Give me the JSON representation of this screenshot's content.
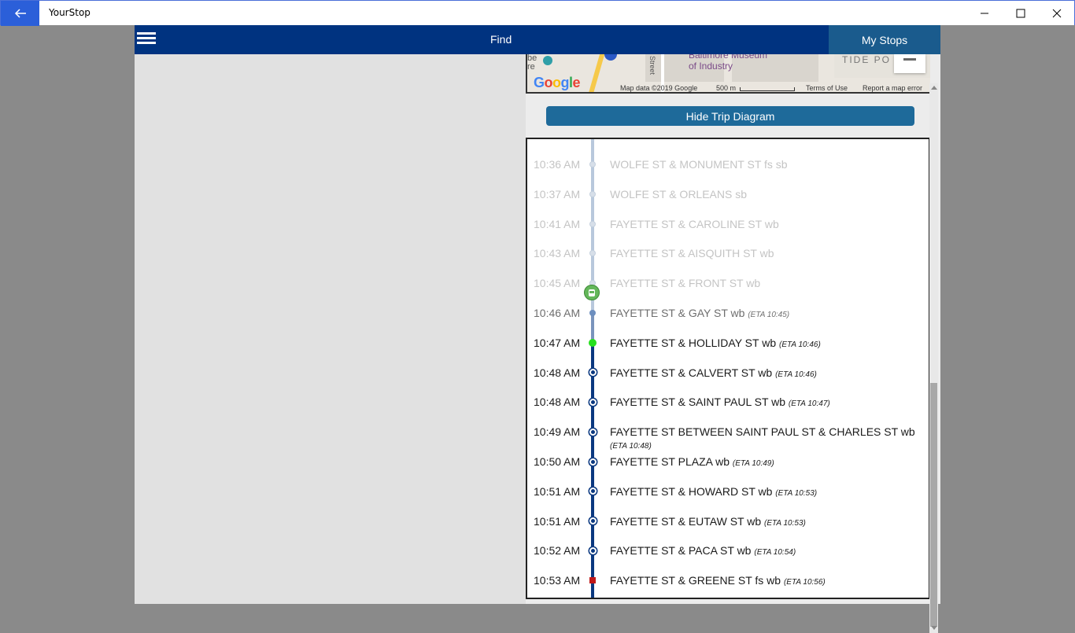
{
  "window": {
    "title": "YourStop",
    "back_icon": "arrow-left-icon",
    "controls": [
      "minimize-icon",
      "maximize-icon",
      "close-icon"
    ]
  },
  "appbar": {
    "menu_icon": "hamburger-icon",
    "find_label": "Find",
    "mystops_label": "My Stops",
    "colors": {
      "bar": "#003380",
      "mystops": "#1a5b8d"
    }
  },
  "map": {
    "labels": {
      "poi_left": "be\nre",
      "museum": "Baltimore Museum\nof Industry",
      "street": "Street",
      "area": "TIDE PO"
    },
    "logo": "Google",
    "attribution": "Map data ©2019 Google",
    "scale": "500 m",
    "terms": "Terms of Use",
    "report": "Report a map error"
  },
  "hide_button": {
    "label": "Hide Trip Diagram",
    "color": "#1e6a9a"
  },
  "trip": {
    "stops": [
      {
        "time": "10:36 AM",
        "name": "WOLFE ST & MONUMENT ST fs sb",
        "eta": "",
        "state": "past"
      },
      {
        "time": "10:37 AM",
        "name": "WOLFE ST & ORLEANS sb",
        "eta": "",
        "state": "past"
      },
      {
        "time": "10:41 AM",
        "name": "FAYETTE ST & CAROLINE ST wb",
        "eta": "",
        "state": "past"
      },
      {
        "time": "10:43 AM",
        "name": "FAYETTE ST & AISQUITH ST wb",
        "eta": "",
        "state": "past"
      },
      {
        "time": "10:45 AM",
        "name": "FAYETTE ST & FRONT ST wb",
        "eta": "",
        "state": "past"
      },
      {
        "time": "10:46 AM",
        "name": "FAYETTE ST & GAY ST wb",
        "eta": "(ETA 10:45)",
        "state": "current"
      },
      {
        "time": "10:47 AM",
        "name": "FAYETTE ST & HOLLIDAY ST wb",
        "eta": "(ETA 10:46)",
        "state": "next"
      },
      {
        "time": "10:48 AM",
        "name": "FAYETTE ST & CALVERT ST wb",
        "eta": "(ETA 10:46)",
        "state": "future"
      },
      {
        "time": "10:48 AM",
        "name": "FAYETTE ST & SAINT PAUL ST wb",
        "eta": "(ETA 10:47)",
        "state": "future"
      },
      {
        "time": "10:49 AM",
        "name": "FAYETTE ST BETWEEN SAINT PAUL ST & CHARLES ST wb",
        "eta": "(ETA 10:48)",
        "state": "future"
      },
      {
        "time": "10:50 AM",
        "name": "FAYETTE ST PLAZA wb",
        "eta": "(ETA 10:49)",
        "state": "future"
      },
      {
        "time": "10:51 AM",
        "name": "FAYETTE ST & HOWARD ST wb",
        "eta": "(ETA 10:53)",
        "state": "future"
      },
      {
        "time": "10:51 AM",
        "name": "FAYETTE ST & EUTAW ST wb",
        "eta": "(ETA 10:53)",
        "state": "future"
      },
      {
        "time": "10:52 AM",
        "name": "FAYETTE ST & PACA ST wb",
        "eta": "(ETA 10:54)",
        "state": "future"
      },
      {
        "time": "10:53 AM",
        "name": "FAYETTE ST & GREENE ST fs wb",
        "eta": "(ETA 10:56)",
        "state": "end"
      }
    ],
    "bus_icon": "bus-icon",
    "colors": {
      "past_line": "#b8c8dc",
      "future_line": "#0a3880",
      "next_dot": "#27e01e",
      "end_marker": "#c01818"
    }
  }
}
